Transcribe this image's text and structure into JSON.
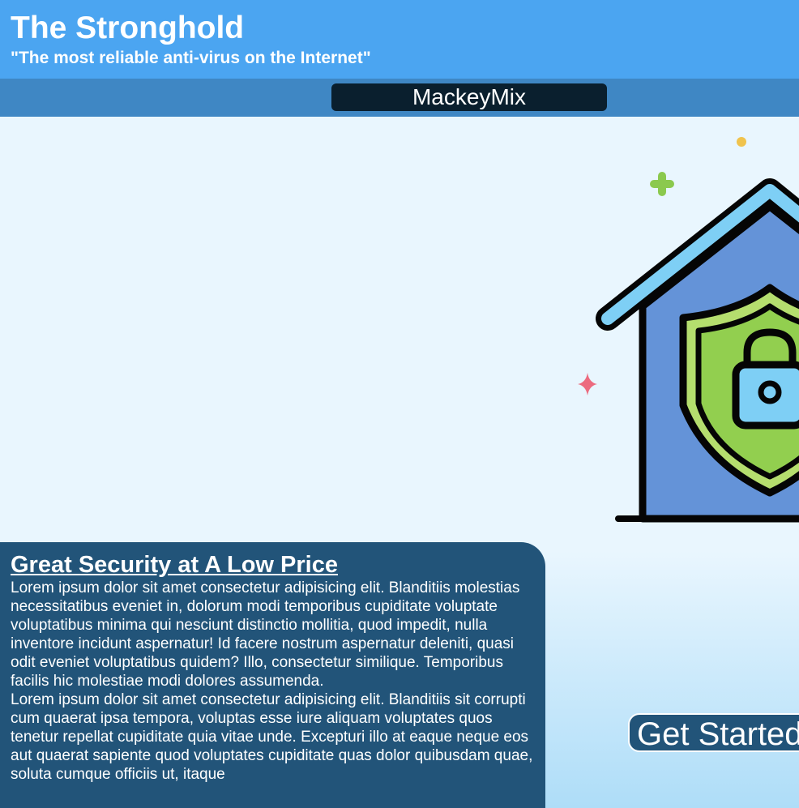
{
  "header": {
    "title": "The Stronghold",
    "tagline": "\"The most reliable anti-virus on the Internet\""
  },
  "nav": {
    "brand": "MackeyMix"
  },
  "hero": {
    "illustration": "house-shield-lock-icon",
    "colors": {
      "roof": "#7ecff5",
      "house": "#6493d8",
      "shield": "#92cf4f",
      "lock": "#7ecff5",
      "sparkle_pink": "#ec6b7f",
      "sparkle_green": "#8bc94e",
      "dot_yellow": "#f0c34d"
    }
  },
  "card": {
    "heading": "Great Security at A Low Price",
    "paragraph1": "Lorem ipsum dolor sit amet consectetur adipisicing elit. Blanditiis molestias necessitatibus eveniet in, dolorum modi temporibus cupiditate voluptate voluptatibus minima qui nesciunt distinctio mollitia, quod impedit, nulla inventore incidunt aspernatur! Id facere nostrum aspernatur deleniti, quasi odit eveniet voluptatibus quidem? Illo, consectetur similique. Temporibus facilis hic molestiae modi dolores assumenda.",
    "paragraph2": "Lorem ipsum dolor sit amet consectetur adipisicing elit. Blanditiis sit corrupti cum quaerat ipsa tempora, voluptas esse iure aliquam voluptates quos tenetur repellat cupiditate quia vitae unde. Excepturi illo at eaque neque eos aut quaerat sapiente quod voluptates cupiditate quas dolor quibusdam quae, soluta cumque officiis ut, itaque"
  },
  "cta": {
    "label": "Get Started"
  },
  "colors": {
    "header_bg": "#4ba5f1",
    "nav_bg": "#3f87c4",
    "brand_bg": "#0a1f2e",
    "card_bg": "#225479",
    "page_bg": "#e9f6fe"
  }
}
